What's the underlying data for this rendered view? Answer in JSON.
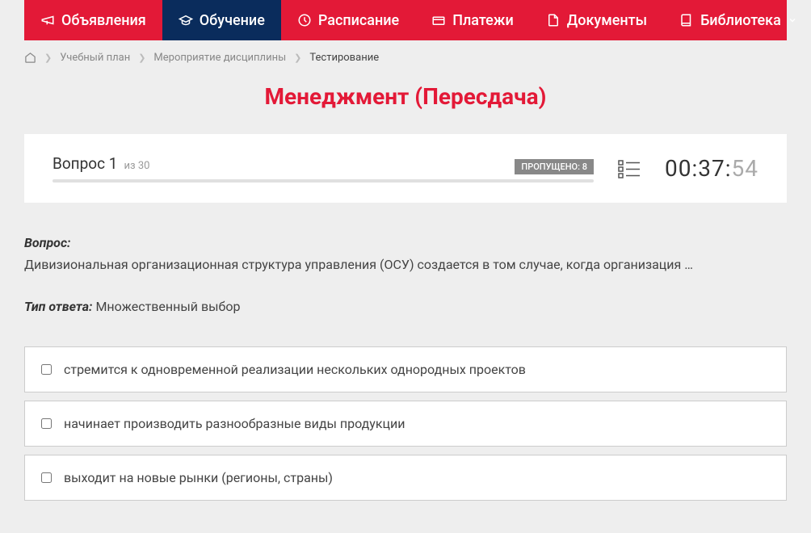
{
  "nav": {
    "items": [
      {
        "label": "Объявления"
      },
      {
        "label": "Обучение"
      },
      {
        "label": "Расписание"
      },
      {
        "label": "Платежи"
      },
      {
        "label": "Документы"
      },
      {
        "label": "Библиотека"
      }
    ]
  },
  "breadcrumb": {
    "items": [
      {
        "label": "Учебный план"
      },
      {
        "label": "Мероприятие дисциплины"
      }
    ],
    "current": "Тестирование"
  },
  "page_title": "Менеджмент (Пересдача)",
  "status": {
    "question_label": "Вопрос 1",
    "question_total": "из 30",
    "skipped_label": "ПРОПУЩЕНО: 8",
    "timer_main": "00:37:",
    "timer_sec": "54"
  },
  "question": {
    "label": "Вопрос:",
    "text": "Дивизиональная организационная структура управления (ОСУ) создается в том случае, когда организация …"
  },
  "answer_type": {
    "label": "Тип ответа:",
    "value": "Множественный выбор"
  },
  "answers": [
    {
      "text": "стремится к одновременной реализации нескольких однородных проектов"
    },
    {
      "text": "начинает производить разнообразные виды продукции"
    },
    {
      "text": "выходит на новые рынки (регионы, страны)"
    }
  ]
}
